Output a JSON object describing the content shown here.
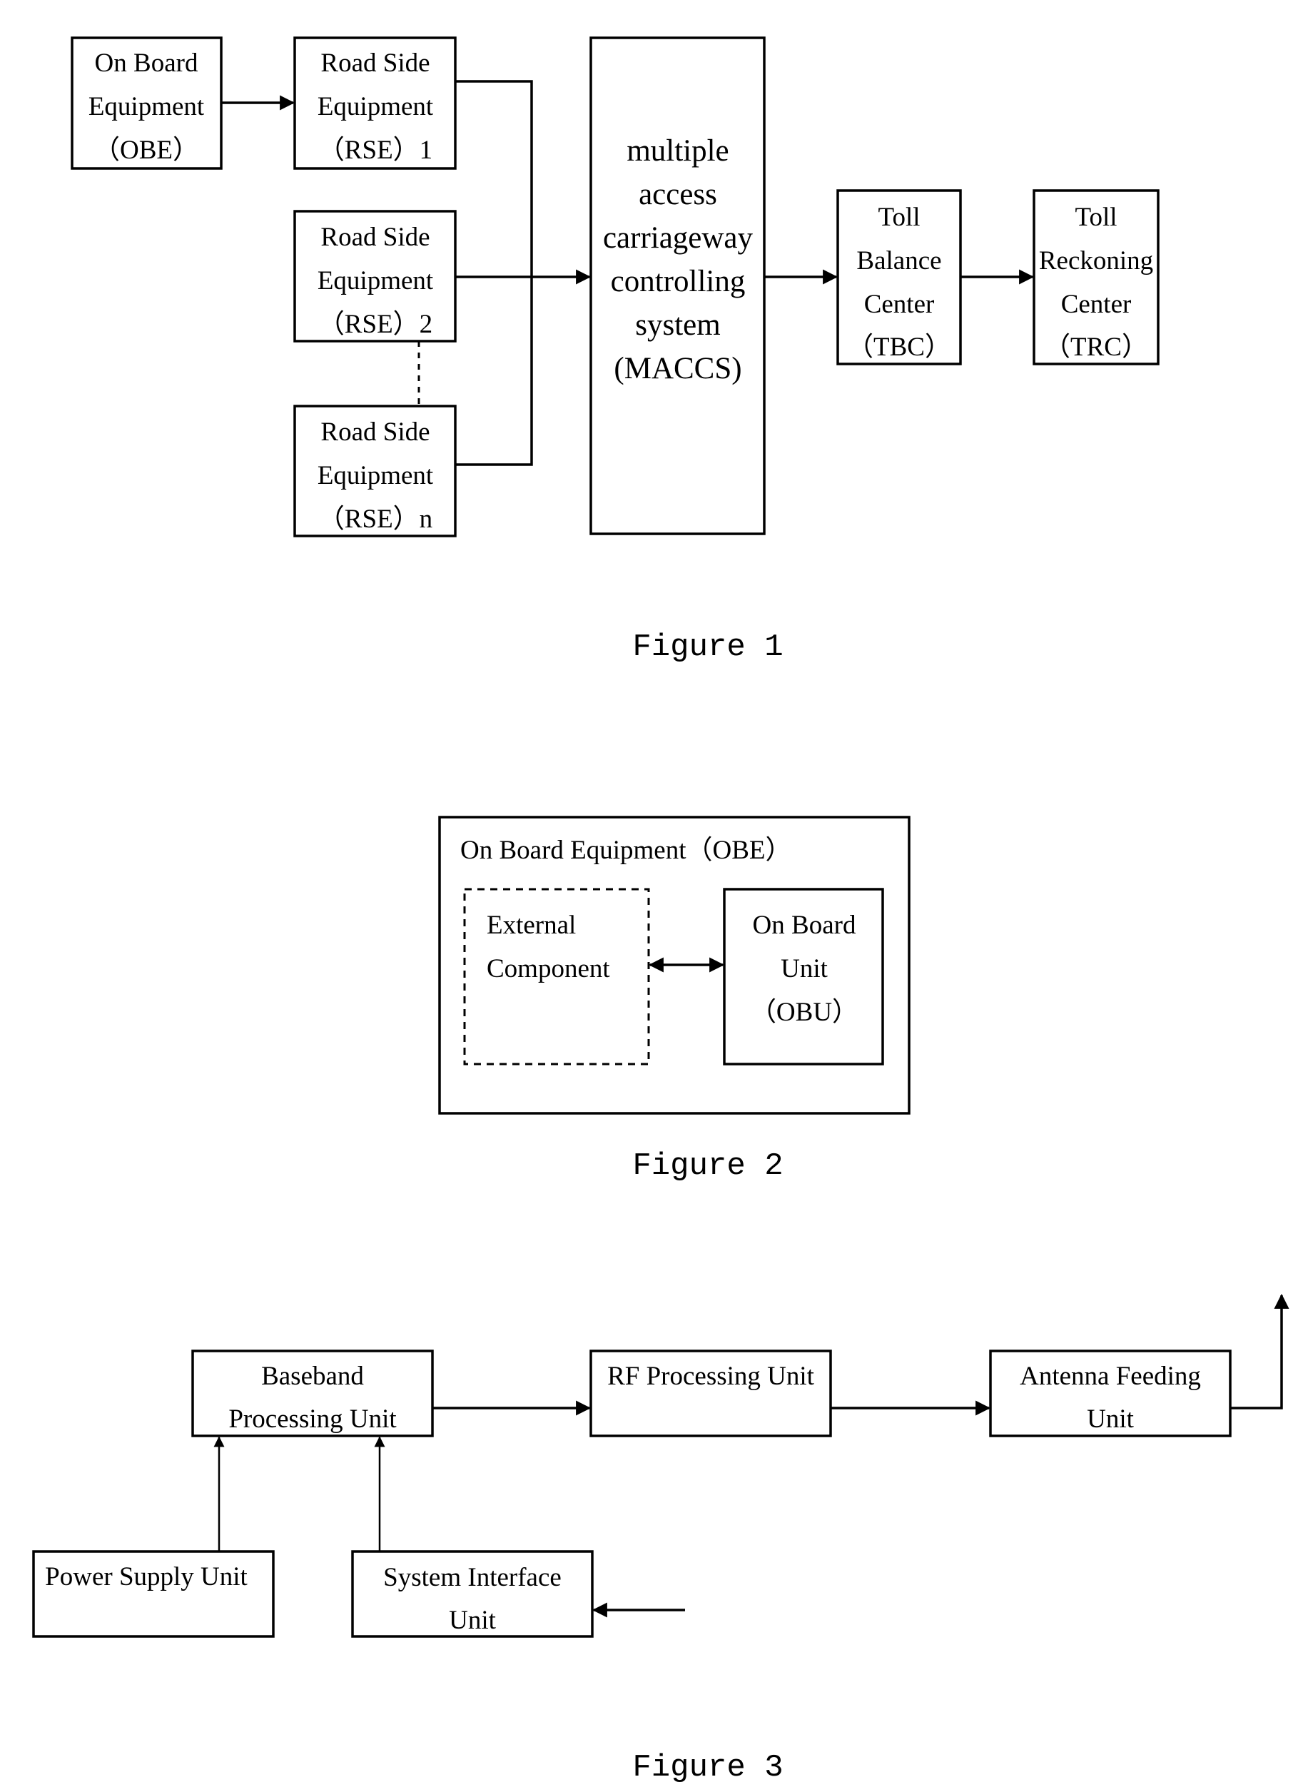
{
  "figure1": {
    "caption": "Figure 1",
    "obe": [
      "On Board",
      "Equipment",
      "（OBE）"
    ],
    "rse1": [
      "Road Side",
      "Equipment",
      "（RSE）1"
    ],
    "rse2": [
      "Road Side",
      "Equipment",
      "（RSE）2"
    ],
    "rsen": [
      "Road Side",
      "Equipment",
      "（RSE）n"
    ],
    "maccs": [
      "multiple",
      "access",
      "carriageway",
      "controlling",
      "system",
      "(MACCS)"
    ],
    "tbc": [
      "Toll",
      "Balance",
      "Center",
      "（TBC）"
    ],
    "trc": [
      "Toll",
      "Reckoning",
      "Center",
      "（TRC）"
    ]
  },
  "figure2": {
    "caption": "Figure 2",
    "container_title": "On Board Equipment（OBE）",
    "external": [
      "External",
      "Component"
    ],
    "obu": [
      "On Board",
      "Unit",
      "（OBU）"
    ]
  },
  "figure3": {
    "caption": "Figure 3",
    "baseband": [
      "Baseband",
      "Processing Unit"
    ],
    "rf": [
      "RF Processing Unit"
    ],
    "antenna": [
      "Antenna Feeding",
      "Unit"
    ],
    "power": [
      "Power Supply Unit"
    ],
    "sysif": [
      "System Interface",
      "Unit"
    ]
  }
}
